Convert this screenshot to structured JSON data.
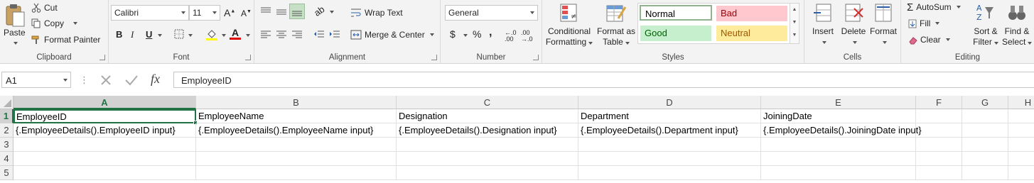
{
  "ribbon": {
    "clipboard": {
      "label": "Clipboard",
      "paste": "Paste",
      "cut": "Cut",
      "copy": "Copy",
      "format_painter": "Format Painter"
    },
    "font": {
      "label": "Font",
      "font_name": "Calibri",
      "font_size": "11",
      "bold": "B",
      "italic": "I",
      "underline": "U"
    },
    "alignment": {
      "label": "Alignment",
      "wrap_text": "Wrap Text",
      "merge_center": "Merge & Center"
    },
    "number": {
      "label": "Number",
      "format": "General",
      "currency": "$",
      "percent": "%",
      "comma": ","
    },
    "styles": {
      "label": "Styles",
      "conditional_formatting": [
        "Conditional",
        "Formatting"
      ],
      "format_as_table": [
        "Format as",
        "Table"
      ],
      "normal": "Normal",
      "bad": "Bad",
      "good": "Good",
      "neutral": "Neutral"
    },
    "cells": {
      "label": "Cells",
      "insert": "Insert",
      "delete": "Delete",
      "format": "Format"
    },
    "editing": {
      "label": "Editing",
      "autosum": "AutoSum",
      "fill": "Fill",
      "clear": "Clear",
      "sort_filter": [
        "Sort &",
        "Filter"
      ],
      "find_select": [
        "Find &",
        "Select"
      ]
    }
  },
  "formula_bar": {
    "name_box": "A1",
    "fx": "fx",
    "value": "EmployeeID"
  },
  "grid": {
    "columns": [
      "A",
      "B",
      "C",
      "D",
      "E",
      "F",
      "G",
      "H"
    ],
    "rows": [
      "1",
      "2",
      "3",
      "4",
      "5"
    ],
    "cells": [
      [
        "EmployeeID",
        "EmployeeName",
        "Designation",
        "Department",
        "JoiningDate"
      ],
      [
        "{.EmployeeDetails().EmployeeID input}",
        "{.EmployeeDetails().EmployeeName input}",
        "{.EmployeeDetails().Designation input}",
        "{.EmployeeDetails().Department input}",
        "{.EmployeeDetails().JoiningDate input}"
      ]
    ],
    "active_cell": "A1"
  },
  "colors": {
    "accent": "#217346",
    "bad_bg": "#ffc7ce",
    "bad_fg": "#9c0006",
    "good_bg": "#c6efce",
    "good_fg": "#006100",
    "neutral_bg": "#ffeb9c",
    "neutral_fg": "#9c5700"
  }
}
